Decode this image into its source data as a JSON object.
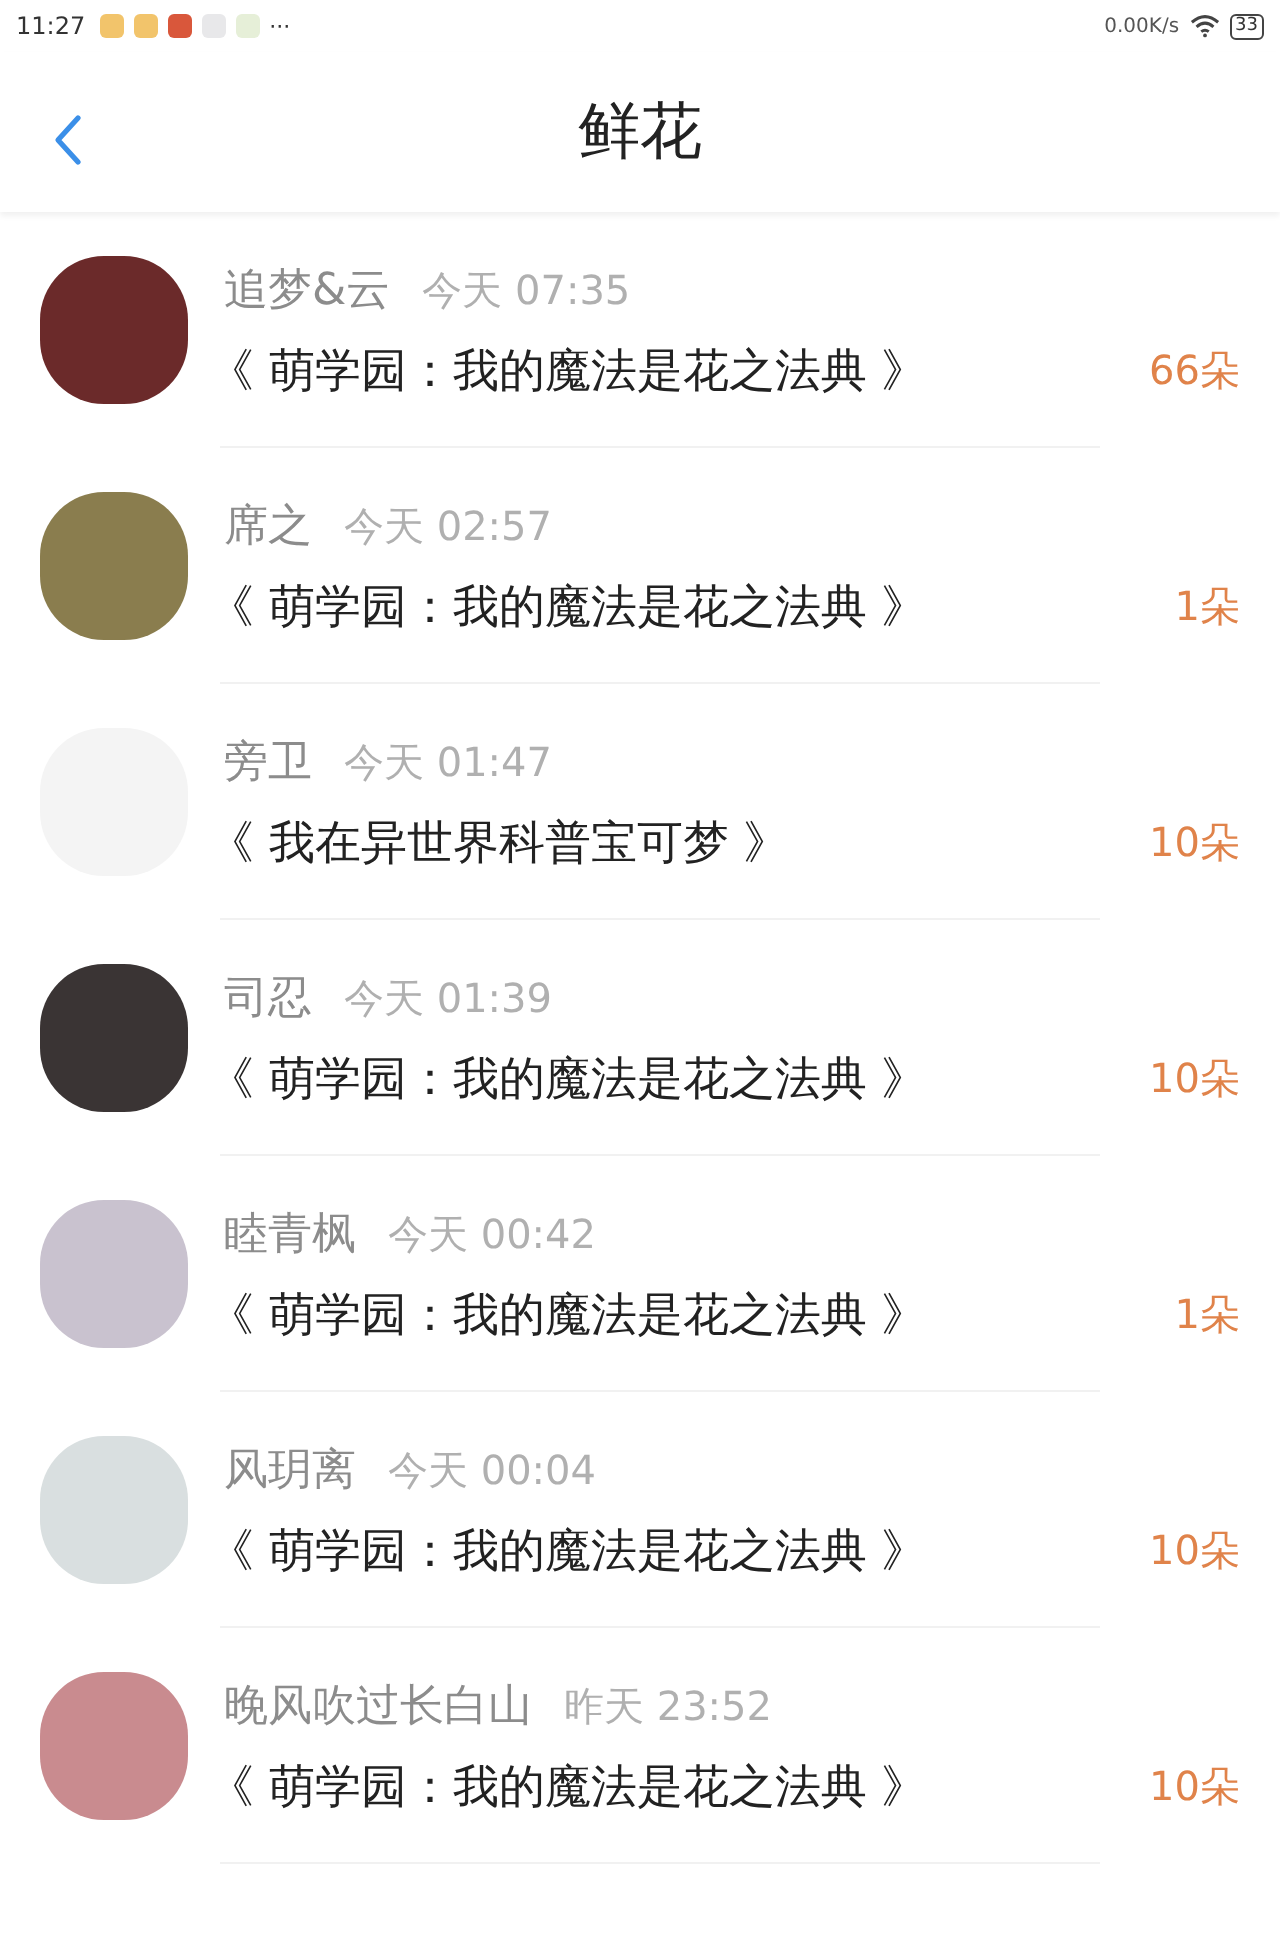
{
  "status_bar": {
    "time": "11:27",
    "more": "···",
    "speed": "0.00K/s",
    "battery": "33"
  },
  "header": {
    "title": "鲜花"
  },
  "items": [
    {
      "name": "追梦&云",
      "time": "今天 07:35",
      "book": "《 萌学园：我的魔法是花之法典 》",
      "count": "66朵"
    },
    {
      "name": "席之",
      "time": "今天 02:57",
      "book": "《 萌学园：我的魔法是花之法典 》",
      "count": "1朵"
    },
    {
      "name": "旁卫",
      "time": "今天 01:47",
      "book": "《 我在异世界科普宝可梦 》",
      "count": "10朵"
    },
    {
      "name": "司忍",
      "time": "今天 01:39",
      "book": "《 萌学园：我的魔法是花之法典 》",
      "count": "10朵"
    },
    {
      "name": "睦青枫",
      "time": "今天 00:42",
      "book": "《 萌学园：我的魔法是花之法典 》",
      "count": "1朵"
    },
    {
      "name": "风玥离",
      "time": "今天 00:04",
      "book": "《 萌学园：我的魔法是花之法典 》",
      "count": "10朵"
    },
    {
      "name": "晚风吹过长白山",
      "time": "昨天 23:52",
      "book": "《 萌学园：我的魔法是花之法典 》",
      "count": "10朵"
    }
  ]
}
